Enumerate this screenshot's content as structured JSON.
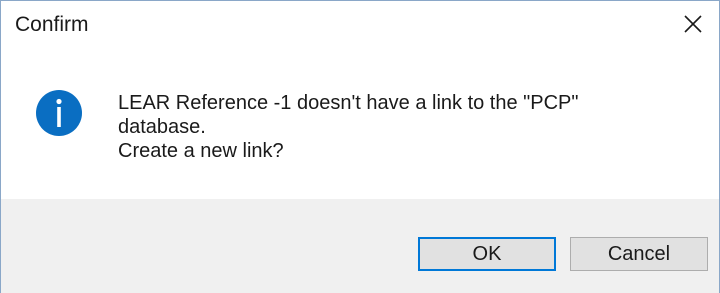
{
  "dialog": {
    "title": "Confirm",
    "close_icon": "close-icon",
    "icon": "info-icon",
    "message_lines": [
      "LEAR Reference -1 doesn't have a link to the \"PCP\"",
      "database.",
      "Create a new link?"
    ],
    "ok_label": "OK",
    "cancel_label": "Cancel"
  },
  "colors": {
    "info_icon": "#0a6ec2",
    "ok_focus_border": "#0078d7",
    "footer_bg": "#f0f0f0",
    "button_bg": "#e1e1e1"
  }
}
